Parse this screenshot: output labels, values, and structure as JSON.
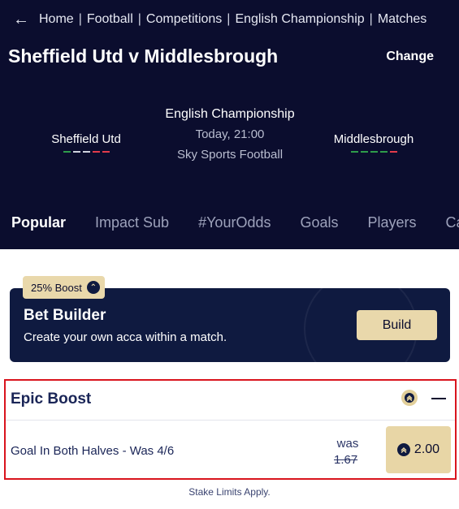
{
  "breadcrumb": {
    "back_icon": "back-arrow-icon",
    "items": [
      "Home",
      "Football",
      "Competitions",
      "English Championship",
      "Matches"
    ]
  },
  "header": {
    "title": "Sheffield Utd v Middlesbrough",
    "change_label": "Change"
  },
  "match": {
    "home_team": "Sheffield Utd",
    "away_team": "Middlesbrough",
    "competition": "English Championship",
    "kickoff": "Today, 21:00",
    "channel": "Sky Sports Football",
    "home_form_colors": [
      "#2e9c4a",
      "#d0d3de",
      "#d0d3de",
      "#e23b4a",
      "#e23b4a"
    ],
    "away_form_colors": [
      "#2e9c4a",
      "#2e9c4a",
      "#2e9c4a",
      "#2e9c4a",
      "#e23b4a"
    ]
  },
  "tabs": [
    "Popular",
    "Impact Sub",
    "#YourOdds",
    "Goals",
    "Players",
    "Ca"
  ],
  "active_tab": "Popular",
  "bet_builder": {
    "badge": "25% Boost",
    "title": "Bet Builder",
    "subtitle": "Create your own acca within a match.",
    "button_label": "Build"
  },
  "epic_boost": {
    "title": "Epic Boost",
    "selection": "Goal In Both Halves - Was 4/6",
    "was_label": "was",
    "was_odds": "1.67",
    "odds": "2.00"
  },
  "footer_note": "Stake Limits Apply.",
  "colors": {
    "header_bg": "#0b0d2e",
    "gold": "#e9d8ab",
    "highlight_border": "#d9141d"
  }
}
